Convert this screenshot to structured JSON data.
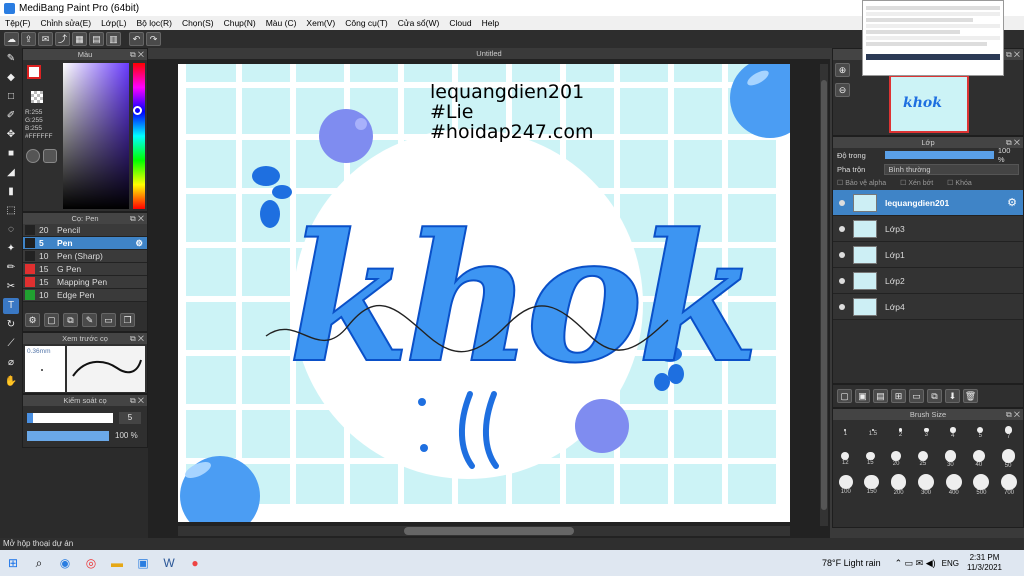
{
  "window": {
    "title": "MediBang Paint Pro (64bit)"
  },
  "menu": [
    "Tệp(F)",
    "Chỉnh sửa(E)",
    "Lớp(L)",
    "Bộ lọc(R)",
    "Chọn(S)",
    "Chụp(N)",
    "Màu (C)",
    "Xem(V)",
    "Công cụ(T)",
    "Cửa sổ(W)",
    "Cloud",
    "Help"
  ],
  "color_panel": {
    "title": "Màu",
    "r": "R:255",
    "g": "G:255",
    "b": "B:255",
    "hex": "#FFFFFF"
  },
  "brush_panel": {
    "title": "Cọ: Pen",
    "items": [
      {
        "size": "20",
        "name": "Pencil",
        "color": "#222222"
      },
      {
        "size": "5",
        "name": "Pen",
        "color": "#1f1f1f"
      },
      {
        "size": "10",
        "name": "Pen (Sharp)",
        "color": "#222222"
      },
      {
        "size": "15",
        "name": "G Pen",
        "color": "#e03030"
      },
      {
        "size": "15",
        "name": "Mapping Pen",
        "color": "#e03030"
      },
      {
        "size": "10",
        "name": "Edge Pen",
        "color": "#20a030"
      }
    ]
  },
  "preview_panel": {
    "title": "Xem trước cọ",
    "size": "0.36mm"
  },
  "control_panel": {
    "title": "Kiểm soát cọ",
    "size": "5",
    "opacity": "100 %",
    "opacity_fraction": 1.0
  },
  "canvas": {
    "title": "Untitled",
    "text1": "lequangdien201",
    "text2": "#Lie",
    "text3": "#hoidap247.com",
    "art_text": "khok"
  },
  "layer_panel": {
    "title": "Lớp",
    "opacity_label": "Độ trong",
    "opacity_value": "100 %",
    "blend_label": "Pha trộn",
    "blend_value": "Bình thường",
    "protect_alpha": "Bảo vệ alpha",
    "clip": "Xén bớt",
    "lock": "Khóa",
    "layers": [
      {
        "name": "lequangdien201",
        "selected": true
      },
      {
        "name": "Lớp3",
        "selected": false
      },
      {
        "name": "Lớp1",
        "selected": false
      },
      {
        "name": "Lớp2",
        "selected": false
      },
      {
        "name": "Lớp4",
        "selected": false
      }
    ]
  },
  "brush_size_panel": {
    "title": "Brush Size",
    "sizes": [
      "1",
      "1.5",
      "2",
      "3",
      "4",
      "5",
      "7",
      "12",
      "15",
      "20",
      "25",
      "30",
      "40",
      "50",
      "100",
      "150",
      "200",
      "300",
      "400",
      "500",
      "700"
    ]
  },
  "status": {
    "text": "Mở hộp thoại dự án"
  },
  "taskbar": {
    "weather": "78°F  Light rain",
    "lang": "ENG",
    "time": "2:31 PM",
    "date": "11/3/2021"
  },
  "colors": {
    "accent": "#3f84c7",
    "canvas_bg": "#ccf3f6",
    "ink": "#1e6fe0"
  }
}
